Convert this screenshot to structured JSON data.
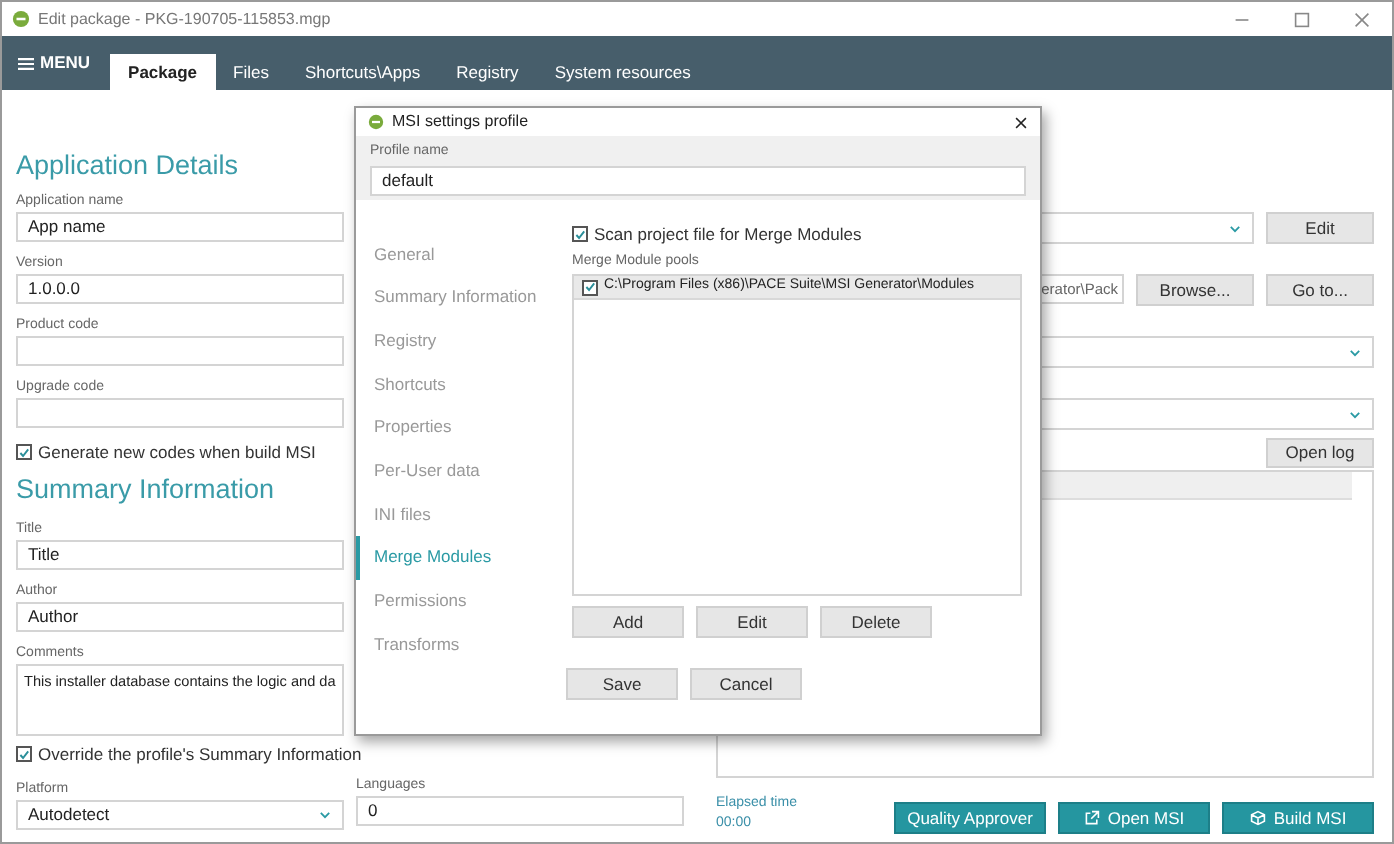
{
  "window": {
    "title": "Edit package - PKG-190705-115853.mgp"
  },
  "menu": {
    "label": "MENU"
  },
  "tabs": [
    {
      "label": "Package",
      "selected": true
    },
    {
      "label": "Files",
      "selected": false
    },
    {
      "label": "Shortcuts\\Apps",
      "selected": false
    },
    {
      "label": "Registry",
      "selected": false
    },
    {
      "label": "System resources",
      "selected": false
    }
  ],
  "application_details": {
    "heading": "Application Details",
    "fields": [
      {
        "label": "Application name",
        "value": "App name"
      },
      {
        "label": "Version",
        "value": "1.0.0.0"
      },
      {
        "label": "Product code"
      },
      {
        "label": "Upgrade code"
      }
    ],
    "generate_codes": {
      "label": "Generate new codes when build MSI",
      "checked": true
    }
  },
  "summary_information": {
    "heading": "Summary Information",
    "fields": [
      {
        "label": "Title",
        "value": "Title"
      },
      {
        "label": "Author",
        "value": "Author"
      }
    ],
    "comments": {
      "label": "Comments",
      "value": "This installer database contains the logic and da"
    },
    "override": {
      "label": "Override the profile's Summary Information",
      "checked": true
    }
  },
  "platform": {
    "label": "Platform",
    "value": "Autodetect"
  },
  "languages": {
    "label": "Languages",
    "value": "0"
  },
  "right_panel": {
    "edit_button": "Edit",
    "path": {
      "value": "erator\\Pack",
      "browse": "Browse...",
      "goto": "Go to..."
    },
    "open_log": "Open log"
  },
  "elapsed": {
    "label": "Elapsed time",
    "value": "00:00"
  },
  "actions": [
    {
      "kind": "plain",
      "label": "Quality Approver"
    },
    {
      "kind": "open",
      "label": "Open MSI"
    },
    {
      "kind": "build",
      "label": "Build MSI"
    }
  ],
  "dialog": {
    "title": "MSI settings profile",
    "profile_name": {
      "label": "Profile name",
      "value": "default"
    },
    "nav": [
      {
        "label": "General",
        "selected": false
      },
      {
        "label": "Summary Information",
        "selected": false
      },
      {
        "label": "Registry",
        "selected": false
      },
      {
        "label": "Shortcuts",
        "selected": false
      },
      {
        "label": "Properties",
        "selected": false
      },
      {
        "label": "Per-User data",
        "selected": false
      },
      {
        "label": "INI files",
        "selected": false
      },
      {
        "label": "Merge Modules",
        "selected": true
      },
      {
        "label": "Permissions",
        "selected": false
      },
      {
        "label": "Transforms",
        "selected": false
      }
    ],
    "scan": {
      "label": "Scan project file for Merge Modules",
      "checked": true
    },
    "pools_label": "Merge Module pools",
    "pools": [
      {
        "path": "C:\\Program Files (x86)\\PACE Suite\\MSI Generator\\Modules",
        "checked": true,
        "selected": true
      }
    ],
    "pool_buttons": [
      "Add",
      "Edit",
      "Delete"
    ],
    "footer_buttons": [
      "Save",
      "Cancel"
    ]
  }
}
